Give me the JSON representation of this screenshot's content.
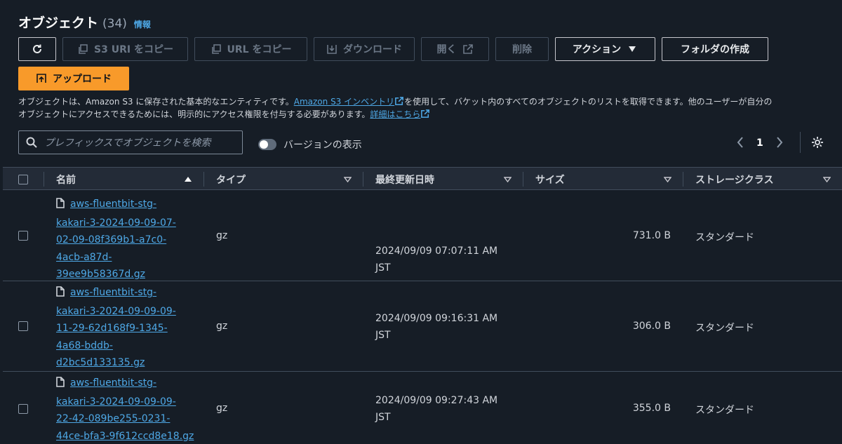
{
  "header": {
    "title": "オブジェクト",
    "count": "(34)",
    "info": "情報"
  },
  "toolbar": {
    "refresh_label": "",
    "copy_s3_uri": "S3 URI をコピー",
    "copy_url": "URL をコピー",
    "download": "ダウンロード",
    "open": "開く",
    "delete": "削除",
    "actions": "アクション",
    "create_folder": "フォルダの作成",
    "upload": "アップロード"
  },
  "description": {
    "part1": "オブジェクトは、Amazon S3 に保存された基本的なエンティティです。",
    "link1": "Amazon S3 インベントリ",
    "part2": "を使用して、バケット内のすべてのオブジェクトのリストを取得できます。他のユーザーが自分の",
    "part3": "オブジェクトにアクセスできるためには、明示的にアクセス権限を付与する必要があります。",
    "link2": "詳細はこちら"
  },
  "search": {
    "placeholder": "プレフィックスでオブジェクトを検索"
  },
  "versions_toggle": {
    "label": "バージョンの表示",
    "on": false
  },
  "pagination": {
    "page": "1"
  },
  "table": {
    "columns": [
      "名前",
      "タイプ",
      "最終更新日時",
      "サイズ",
      "ストレージクラス"
    ],
    "rows": [
      {
        "name_lines": [
          "aws-fluentbit-stg-",
          "kakari-3-2024-09-09-07-",
          "02-09-08f369b1-a7c0-",
          "4acb-a87d-",
          "39ee9b58367d.gz"
        ],
        "type": "gz",
        "modified_line1": "2024/09/09 07:07:11 AM",
        "modified_line2": "JST",
        "size": "731.0 B",
        "storage_class": "スタンダード"
      },
      {
        "name_lines": [
          "aws-fluentbit-stg-",
          "kakari-3-2024-09-09-09-",
          "11-29-62d168f9-1345-",
          "4a68-bddb-",
          "d2bc5d133135.gz"
        ],
        "type": "gz",
        "modified_line1": "2024/09/09 09:16:31 AM",
        "modified_line2": "JST",
        "size": "306.0 B",
        "storage_class": "スタンダード"
      },
      {
        "name_lines": [
          "aws-fluentbit-stg-",
          "kakari-3-2024-09-09-09-",
          "22-42-089be255-0231-",
          "44ce-bfa3-9f612ccd8e18.gz"
        ],
        "type": "gz",
        "modified_line1": "2024/09/09 09:27:43 AM",
        "modified_line2": "JST",
        "size": "355.0 B",
        "storage_class": "スタンダード"
      }
    ]
  },
  "colors": {
    "accent_link": "#4ea8e6",
    "primary_button": "#f89a2a",
    "background": "#161d26"
  }
}
